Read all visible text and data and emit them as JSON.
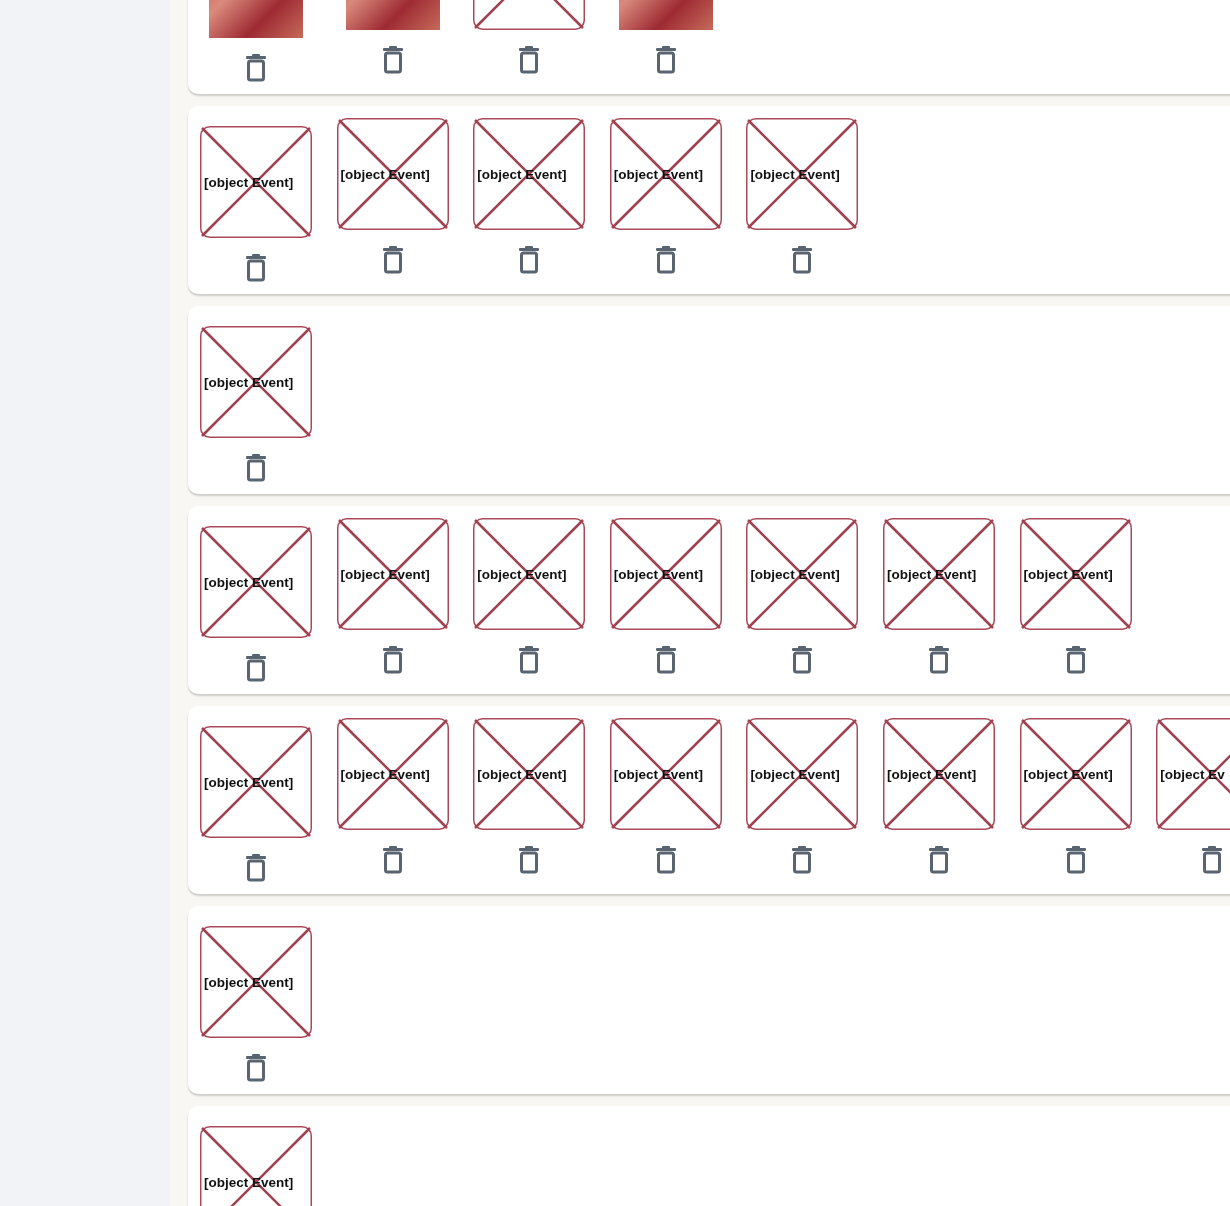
{
  "cards": [
    {
      "images": [
        {
          "kind": "photo"
        },
        {
          "kind": "photo"
        },
        {
          "kind": "broken"
        },
        {
          "kind": "photo"
        }
      ]
    },
    {
      "images": [
        {
          "kind": "broken",
          "alt": "[object Event]"
        },
        {
          "kind": "broken",
          "alt": "[object Event]"
        },
        {
          "kind": "broken",
          "alt": "[object Event]"
        },
        {
          "kind": "broken",
          "alt": "[object Event]"
        },
        {
          "kind": "broken",
          "alt": "[object Event]"
        }
      ]
    },
    {
      "images": [
        {
          "kind": "broken",
          "alt": "[object Event]"
        }
      ]
    },
    {
      "images": [
        {
          "kind": "broken",
          "alt": "[object Event]"
        },
        {
          "kind": "broken",
          "alt": "[object Event]"
        },
        {
          "kind": "broken",
          "alt": "[object Event]"
        },
        {
          "kind": "broken",
          "alt": "[object Event]"
        },
        {
          "kind": "broken",
          "alt": "[object Event]"
        },
        {
          "kind": "broken",
          "alt": "[object Event]"
        },
        {
          "kind": "broken",
          "alt": "[object Event]"
        }
      ]
    },
    {
      "images": [
        {
          "kind": "broken",
          "alt": "[object Event]"
        },
        {
          "kind": "broken",
          "alt": "[object Event]"
        },
        {
          "kind": "broken",
          "alt": "[object Event]"
        },
        {
          "kind": "broken",
          "alt": "[object Event]"
        },
        {
          "kind": "broken",
          "alt": "[object Event]"
        },
        {
          "kind": "broken",
          "alt": "[object Event]"
        },
        {
          "kind": "broken",
          "alt": "[object Event]"
        },
        {
          "kind": "broken",
          "alt": "[object Ev"
        }
      ]
    },
    {
      "images": [
        {
          "kind": "broken",
          "alt": "[object Event]"
        }
      ]
    },
    {
      "images": [
        {
          "kind": "broken",
          "alt": "[object Event]"
        }
      ]
    }
  ]
}
